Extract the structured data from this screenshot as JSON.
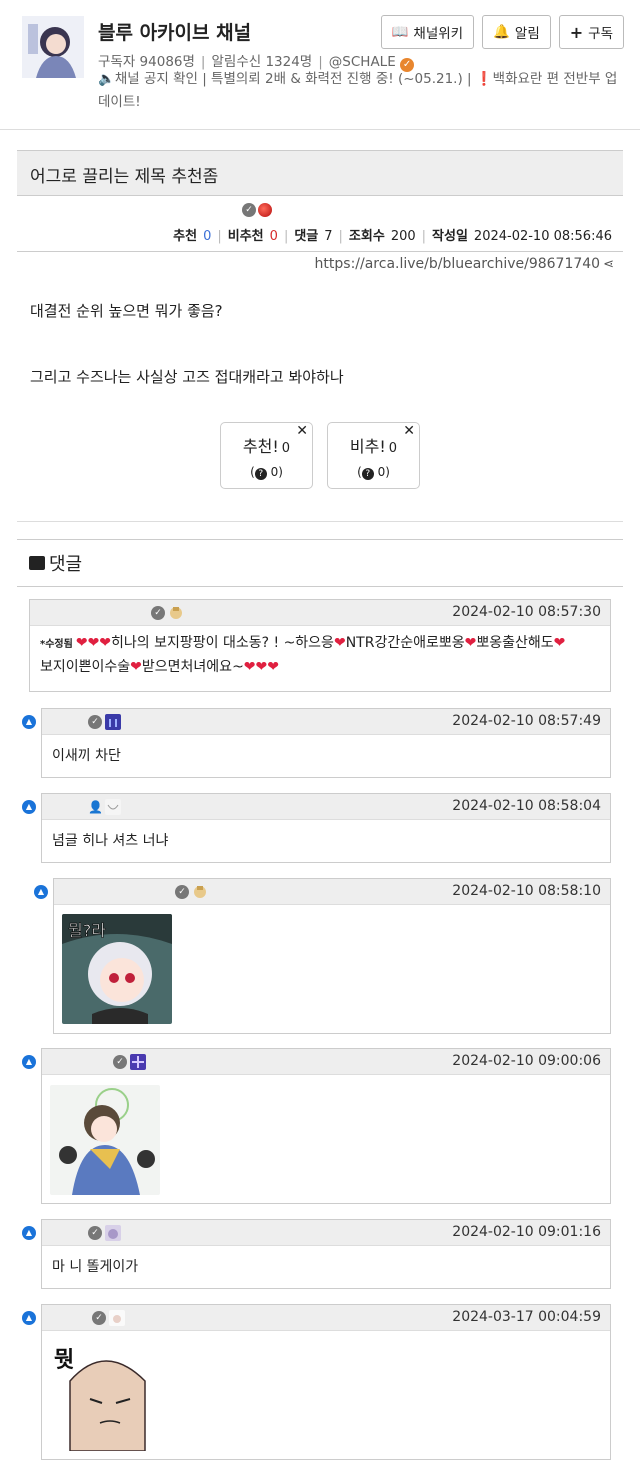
{
  "channel": {
    "title": "블루 아카이브 채널",
    "subscribers": "구독자 94086명",
    "notif": "알림수신 1324명",
    "handle": "@SCHALE",
    "notice": "채널 공지 확인 | 특별의뢰 2배 & 화력전 진행 중! (~05.21.) | ❗백화요란 편 전반부 업데이트!",
    "buttons": {
      "wiki": "채널위키",
      "alarm": "알림",
      "subscribe": "구독"
    }
  },
  "article": {
    "title": "어그로 끌리는 제목 추천좀",
    "stats": {
      "recommend_label": "추천",
      "recommend": "0",
      "unrecommend_label": "비추천",
      "unrecommend": "0",
      "comments_label": "댓글",
      "comments": "7",
      "views_label": "조회수",
      "views": "200",
      "date_label": "작성일",
      "date": "2024-02-10 08:56:46"
    },
    "url": "https://arca.live/b/bluearchive/98671740",
    "body": [
      "대결전 순위 높으면 뭐가 좋음?",
      "그리고 수즈나는 사실상 고즈 접대캐라고 봐야하나"
    ],
    "vote_up": {
      "label": "추천!",
      "count": "0",
      "sub": "0"
    },
    "vote_down": {
      "label": "비추!",
      "count": "0",
      "sub": "0"
    }
  },
  "comments_section": {
    "title": "댓글",
    "items": [
      {
        "date": "2024-02-10 08:57:30",
        "edited": "*수정됨",
        "text": "히나의 보지팡팡이 대소동? ! ~하으응",
        "text2": "NTR강간순애로뽀옹",
        "text3": "뽀옹출산해도",
        "text4": "보지이쁜이수술",
        "text5": "받으면처녀에요~"
      },
      {
        "date": "2024-02-10 08:57:49",
        "text": "이새끼 차단"
      },
      {
        "date": "2024-02-10 08:58:04",
        "text": "념글 히나 셔츠 너냐"
      },
      {
        "date": "2024-02-10 08:58:10"
      },
      {
        "date": "2024-02-10 09:00:06"
      },
      {
        "date": "2024-02-10 09:01:16",
        "text": "마 니 똘게이가"
      },
      {
        "date": "2024-03-17 00:04:59"
      }
    ]
  },
  "colors": {
    "accent_blue": "#1a73d9",
    "recommend_blue": "#3b6fd6",
    "unrecommend_red": "#d62b2b",
    "heart": "#e02040"
  }
}
